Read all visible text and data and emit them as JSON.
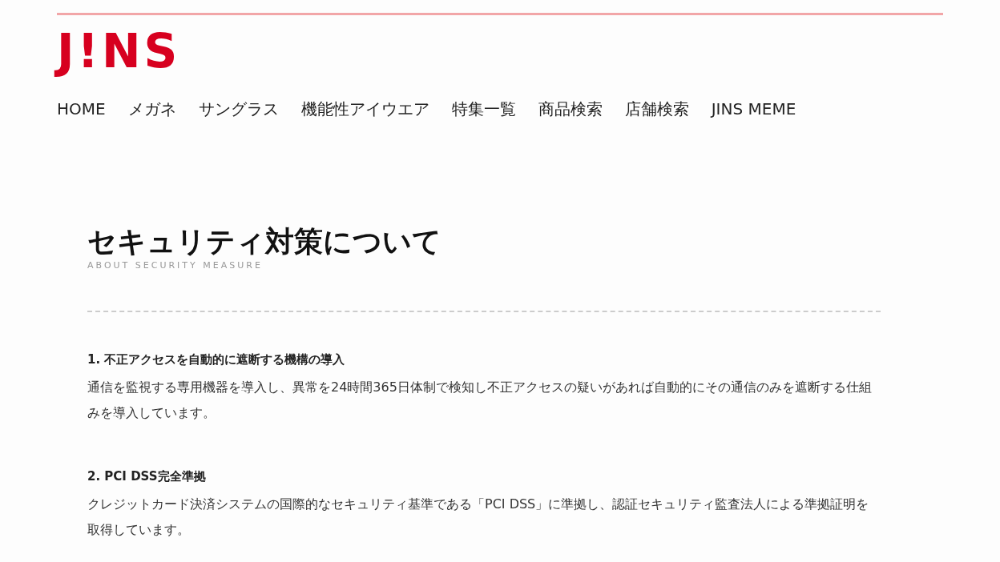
{
  "header": {
    "logo": "J!NS"
  },
  "nav": [
    "HOME",
    "メガネ",
    "サングラス",
    "機能性アイウエア",
    "特集一覧",
    "商品検索",
    "店舗検索",
    "JINS MEME"
  ],
  "page": {
    "title": "セキュリティ対策について",
    "subtitle": "ABOUT SECURITY MEASURE"
  },
  "sections": [
    {
      "heading": "1. 不正アクセスを自動的に遮断する機構の導入",
      "body": "通信を監視する専用機器を導入し、異常を24時間365日体制で検知し不正アクセスの疑いがあれば自動的にその通信のみを遮断する仕組みを導入しています。"
    },
    {
      "heading": "2. PCI DSS完全準拠",
      "body": "クレジットカード決済システムの国際的なセキュリティ基準である「PCI DSS」に準拠し、認証セキュリティ監査法人による準拠証明を取得しています。"
    }
  ]
}
